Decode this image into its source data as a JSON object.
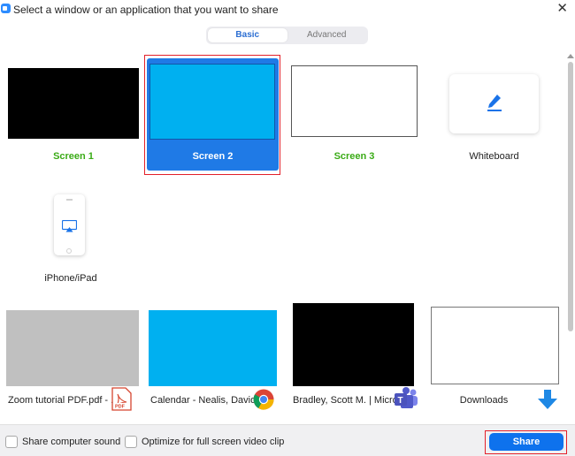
{
  "window": {
    "title": "Select a window or an application that you want to share",
    "close_symbol": "✕",
    "app_icon": "zoom-video-icon"
  },
  "tabs": [
    {
      "label": "Basic",
      "active": true
    },
    {
      "label": "Advanced",
      "active": false
    }
  ],
  "screens": [
    {
      "label": "Screen 1",
      "preview_color": "#000000"
    },
    {
      "label": "Screen 2",
      "preview_color": "#00b0f0",
      "selected": true
    },
    {
      "label": "Screen 3",
      "preview_color": "#ffffff"
    },
    {
      "label": "Whiteboard",
      "icon": "pencil-icon"
    },
    {
      "label": "iPhone/iPad",
      "icon": "airplay-icon"
    }
  ],
  "apps": [
    {
      "label": "Zoom tutorial PDF.pdf - ...",
      "preview_color": "#c0c0c0",
      "icon": "pdf-icon",
      "icon_text": "PDF"
    },
    {
      "label": "Calendar - Nealis, David ...",
      "preview_color": "#00b0f0",
      "icon": "chrome-icon"
    },
    {
      "label": "Bradley, Scott M. | Micro...",
      "preview_color": "#000000",
      "icon": "teams-icon",
      "icon_text": "T"
    },
    {
      "label": "Downloads",
      "preview_color": "#ffffff",
      "icon": "download-arrow-icon"
    }
  ],
  "footer": {
    "share_sound_label": "Share computer sound",
    "optimize_label": "Optimize for full screen video clip",
    "share_button": "Share"
  },
  "colors": {
    "accent": "#0e72ed",
    "selected_tile": "#1f7ae6",
    "highlight_outline": "#e3202a",
    "screen_label_green": "#3aab16"
  }
}
